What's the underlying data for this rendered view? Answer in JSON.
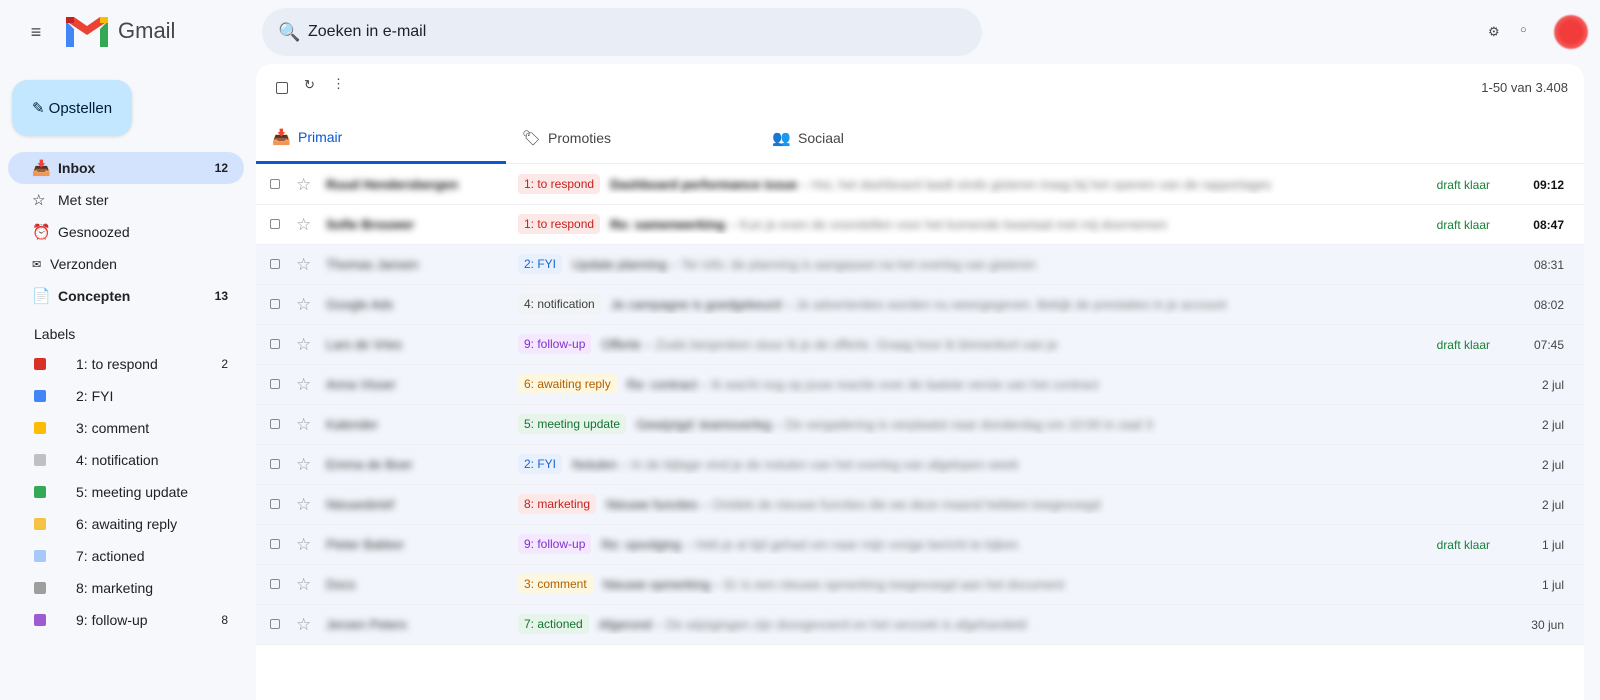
{
  "header": {
    "app_name": "Gmail",
    "search_placeholder": "Zoeken in e-mail"
  },
  "sidebar": {
    "compose_label": "✎ Opstellen",
    "items": [
      {
        "icon": "📥",
        "label": "Inbox",
        "count": "12"
      },
      {
        "icon": "☆",
        "label": "Met ster",
        "count": ""
      },
      {
        "icon": "⏰",
        "label": "Gesnoozed",
        "count": ""
      },
      {
        "icon": "✉",
        "label": "Verzonden",
        "count": ""
      },
      {
        "icon": "📄",
        "label": "Concepten",
        "count": "13"
      }
    ],
    "labels_title": "Labels",
    "labels": [
      {
        "name": "1: to respond",
        "color": "#d93025",
        "count": "2"
      },
      {
        "name": "2: FYI",
        "color": "#4285f4",
        "count": ""
      },
      {
        "name": "3: comment",
        "color": "#fbbc04",
        "count": ""
      },
      {
        "name": "4: notification",
        "color": "#bdc1c6",
        "count": ""
      },
      {
        "name": "5: meeting update",
        "color": "#34a853",
        "count": ""
      },
      {
        "name": "6: awaiting reply",
        "color": "#f6c244",
        "count": ""
      },
      {
        "name": "7: actioned",
        "color": "#a8c7fa",
        "count": ""
      },
      {
        "name": "8: marketing",
        "color": "#9e9e9e",
        "count": ""
      },
      {
        "name": "9: follow-up",
        "color": "#9c5bd1",
        "count": "8"
      }
    ]
  },
  "toolbar": {
    "pager": "1-50 van 3.408"
  },
  "tabs": [
    {
      "icon": "📥",
      "label": "Primair"
    },
    {
      "icon": "🏷",
      "label": "Promoties"
    },
    {
      "icon": "👥",
      "label": "Sociaal"
    }
  ],
  "chip_styles": {
    "1": {
      "bg": "#fce8e6",
      "fg": "#c5221f"
    },
    "2": {
      "bg": "#e8f0fe",
      "fg": "#1967d2"
    },
    "3": {
      "bg": "#fef7e0",
      "fg": "#b06000"
    },
    "4": {
      "bg": "#f1f3f4",
      "fg": "#3c4043"
    },
    "5": {
      "bg": "#e6f4ea",
      "fg": "#137333"
    },
    "6": {
      "bg": "#fef7e0",
      "fg": "#b06000"
    },
    "7": {
      "bg": "#e6f4ea",
      "fg": "#137333"
    },
    "8": {
      "bg": "#fce8e6",
      "fg": "#c5221f"
    },
    "9": {
      "bg": "#f3e8fd",
      "fg": "#8430ce"
    }
  },
  "emails": [
    {
      "unread": true,
      "sender": "Ruud Hendersbergen",
      "label": "1: to respond",
      "label_key": "1",
      "subject": "Dashboard performance issue",
      "preview": "Hoi, het dashboard laadt sinds gisteren traag bij het openen van de rapportages",
      "draft": "draft klaar",
      "time": "09:12"
    },
    {
      "unread": true,
      "sender": "Sofie Brouwer",
      "label": "1: to respond",
      "label_key": "1",
      "subject": "Re: samenwerking",
      "preview": "Kun je even de voorstellen voor het komende kwartaal met mij doornemen",
      "draft": "draft klaar",
      "time": "08:47"
    },
    {
      "unread": false,
      "sender": "Thomas Jansen",
      "label": "2: FYI",
      "label_key": "2",
      "subject": "Update planning",
      "preview": "Ter info: de planning is aangepast na het overleg van gisteren",
      "draft": "",
      "time": "08:31"
    },
    {
      "unread": false,
      "sender": "Google Ads",
      "label": "4: notification",
      "label_key": "4",
      "subject": "Je campagne is goedgekeurd",
      "preview": "Je advertenties worden nu weergegeven. Bekijk de prestaties in je account",
      "draft": "",
      "time": "08:02"
    },
    {
      "unread": false,
      "sender": "Lars de Vries",
      "label": "9: follow-up",
      "label_key": "9",
      "subject": "Offerte",
      "preview": "Zoals besproken stuur ik je de offerte. Graag hoor ik binnenkort van je",
      "draft": "draft klaar",
      "time": "07:45"
    },
    {
      "unread": false,
      "sender": "Anna Visser",
      "label": "6: awaiting reply",
      "label_key": "6",
      "subject": "Re: contract",
      "preview": "Ik wacht nog op jouw reactie over de laatste versie van het contract",
      "draft": "",
      "time": "2 jul"
    },
    {
      "unread": false,
      "sender": "Kalender",
      "label": "5: meeting update",
      "label_key": "5",
      "subject": "Gewijzigd: teamoverleg",
      "preview": "De vergadering is verplaatst naar donderdag om 10:00 in zaal 3",
      "draft": "",
      "time": "2 jul"
    },
    {
      "unread": false,
      "sender": "Emma de Boer",
      "label": "2: FYI",
      "label_key": "2",
      "subject": "Notulen",
      "preview": "In de bijlage vind je de notulen van het overleg van afgelopen week",
      "draft": "",
      "time": "2 jul"
    },
    {
      "unread": false,
      "sender": "Nieuwsbrief",
      "label": "8: marketing",
      "label_key": "8",
      "subject": "Nieuwe functies",
      "preview": "Ontdek de nieuwe functies die we deze maand hebben toegevoegd",
      "draft": "",
      "time": "2 jul"
    },
    {
      "unread": false,
      "sender": "Pieter Bakker",
      "label": "9: follow-up",
      "label_key": "9",
      "subject": "Re: opvolging",
      "preview": "Heb je al tijd gehad om naar mijn vorige bericht te kijken",
      "draft": "draft klaar",
      "time": "1 jul"
    },
    {
      "unread": false,
      "sender": "Docs",
      "label": "3: comment",
      "label_key": "3",
      "subject": "Nieuwe opmerking",
      "preview": "Er is een nieuwe opmerking toegevoegd aan het document",
      "draft": "",
      "time": "1 jul"
    },
    {
      "unread": false,
      "sender": "Jeroen Peters",
      "label": "7: actioned",
      "label_key": "7",
      "subject": "Afgerond",
      "preview": "De wijzigingen zijn doorgevoerd en het verzoek is afgehandeld",
      "draft": "",
      "time": "30 jun"
    }
  ]
}
